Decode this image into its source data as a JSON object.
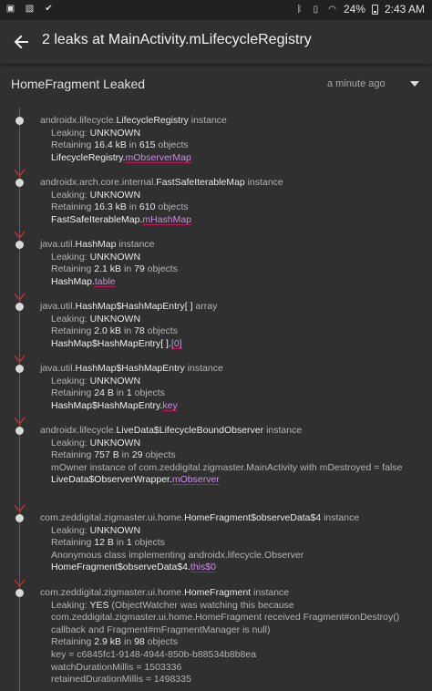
{
  "status_bar": {
    "time": "2:43 AM",
    "battery": "24%",
    "icons": [
      "gallery-icon",
      "image-icon",
      "check-icon",
      "bell-icon",
      "bluetooth-icon",
      "vibrate-icon",
      "wifi-icon",
      "battery-icon"
    ]
  },
  "app_bar": {
    "title": "2 leaks at MainActivity.mLifecycleRegistry"
  },
  "leak": {
    "title": "HomeFragment Leaked",
    "time": "a minute ago"
  },
  "colors": {
    "background": "#303030",
    "rail": "#d32f2f",
    "field_link": "#c78ee0",
    "underline": "#c2185b"
  },
  "nodes": [
    {
      "prefix": "androidx.lifecycle.",
      "cls": "LifecycleRegistry",
      "suffix": " instance",
      "leaking_label": "Leaking: ",
      "leaking": "UNKNOWN",
      "retaining_label": "Retaining ",
      "size": "16.4 kB",
      "in_label": " in ",
      "count": "615",
      "objects_label": " objects",
      "ref_class": "LifecycleRegistry.",
      "ref_field": "mObserverMap"
    },
    {
      "prefix": "androidx.arch.core.internal.",
      "cls": "FastSafeIterableMap",
      "suffix": " instance",
      "leaking_label": "Leaking: ",
      "leaking": "UNKNOWN",
      "retaining_label": "Retaining ",
      "size": "16.3 kB",
      "in_label": " in ",
      "count": "610",
      "objects_label": " objects",
      "ref_class": "FastSafeIterableMap.",
      "ref_field": "mHashMap"
    },
    {
      "prefix": "java.util.",
      "cls": "HashMap",
      "suffix": " instance",
      "leaking_label": "Leaking: ",
      "leaking": "UNKNOWN",
      "retaining_label": "Retaining ",
      "size": "2.1 kB",
      "in_label": " in ",
      "count": "79",
      "objects_label": " objects",
      "ref_class": "HashMap.",
      "ref_field": "table"
    },
    {
      "prefix": "java.util.",
      "cls": "HashMap$HashMapEntry[ ]",
      "suffix": " array",
      "leaking_label": "Leaking: ",
      "leaking": "UNKNOWN",
      "retaining_label": "Retaining ",
      "size": "2.0 kB",
      "in_label": " in ",
      "count": "78",
      "objects_label": " objects",
      "ref_class": "HashMap$HashMapEntry[ ].",
      "ref_field": "[0]"
    },
    {
      "prefix": "java.util.",
      "cls": "HashMap$HashMapEntry",
      "suffix": " instance",
      "leaking_label": "Leaking: ",
      "leaking": "UNKNOWN",
      "retaining_label": "Retaining ",
      "size": "24 B",
      "in_label": " in ",
      "count": "1",
      "objects_label": " objects",
      "ref_class": "HashMap$HashMapEntry.",
      "ref_field": "key"
    },
    {
      "prefix": "androidx.lifecycle.",
      "cls": "LiveData$LifecycleBoundObserver",
      "suffix": " instance",
      "leaking_label": "Leaking: ",
      "leaking": "UNKNOWN",
      "retaining_label": "Retaining ",
      "size": "757 B",
      "in_label": " in ",
      "count": "29",
      "objects_label": " objects",
      "extra": "mOwner instance of com.zeddigital.zigmaster.MainActivity with mDestroyed = false",
      "ref_class": "LiveData$ObserverWrapper.",
      "ref_field": "mObserver"
    },
    {
      "prefix": "com.zeddigital.zigmaster.ui.home.",
      "cls": "HomeFragment$observeData$4",
      "suffix": " instance",
      "leaking_label": "Leaking: ",
      "leaking": "UNKNOWN",
      "retaining_label": "Retaining ",
      "size": "12 B",
      "in_label": " in ",
      "count": "1",
      "objects_label": " objects",
      "extra": "Anonymous class implementing androidx.lifecycle.Observer",
      "ref_class": "HomeFragment$observeData$4.",
      "ref_field": "this$0"
    },
    {
      "prefix": "com.zeddigital.zigmaster.ui.home.",
      "cls": "HomeFragment",
      "suffix": " instance",
      "leaking_label": "Leaking: ",
      "leaking": "YES",
      "leaking_detail": " (ObjectWatcher was watching this because com.zeddigital.zigmaster.ui.home.HomeFragment received Fragment#onDestroy() callback and Fragment#mFragmentManager is null)",
      "retaining_label": "Retaining ",
      "size": "2.9 kB",
      "in_label": " in ",
      "count": "98",
      "objects_label": " objects",
      "key_line": "key = c6845fc1-9148-4944-850b-b88534b8b8ea",
      "watch_line": "watchDurationMillis = 1503336",
      "retained_line": "retainedDurationMillis = 1498335"
    }
  ]
}
